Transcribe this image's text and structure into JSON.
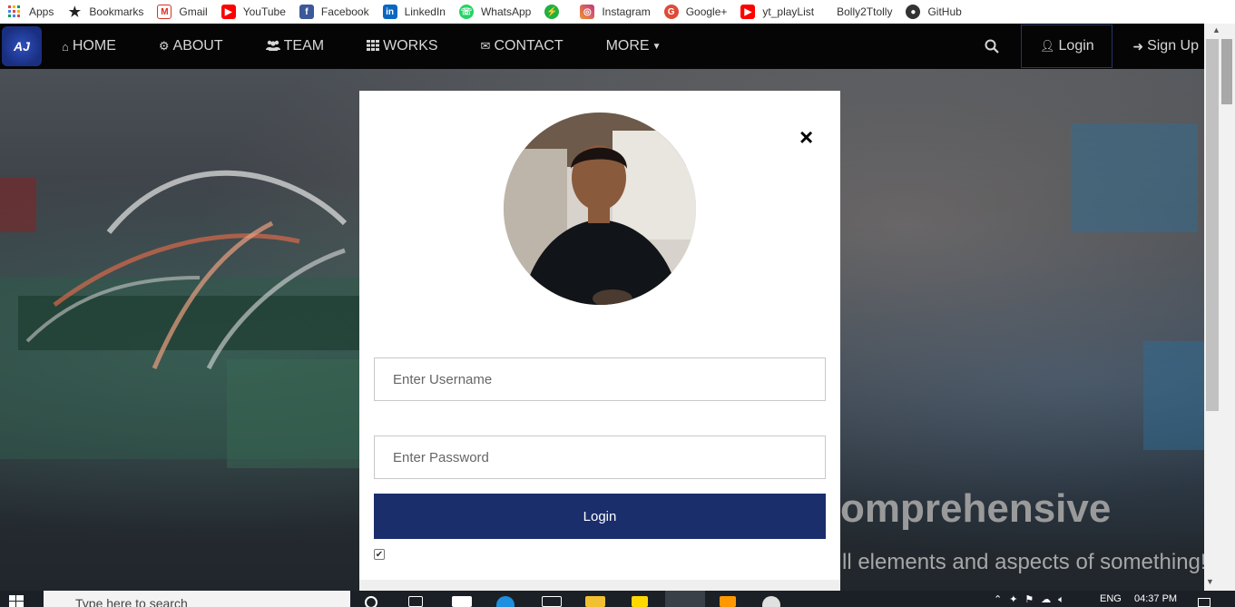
{
  "bookmarks": [
    {
      "label": "Apps",
      "icon": "apps-grid-icon",
      "color": "#e04a3f"
    },
    {
      "label": "Bookmarks",
      "icon": "star-icon",
      "color": "#222222"
    },
    {
      "label": "Gmail",
      "icon": "gmail-icon",
      "color": "#d93025"
    },
    {
      "label": "YouTube",
      "icon": "youtube-icon",
      "color": "#ff0000"
    },
    {
      "label": "Facebook",
      "icon": "facebook-icon",
      "color": "#3b5998"
    },
    {
      "label": "LinkedIn",
      "icon": "linkedin-icon",
      "color": "#0a66c2"
    },
    {
      "label": "WhatsApp",
      "icon": "whatsapp-icon",
      "color": "#25d366"
    },
    {
      "label": "",
      "icon": "bolt-icon",
      "color": "#1fb141"
    },
    {
      "label": "Instagram",
      "icon": "instagram-icon",
      "color": "#c13584"
    },
    {
      "label": "Google+",
      "icon": "google-plus-icon",
      "color": "#dd4b39"
    },
    {
      "label": "yt_playList",
      "icon": "youtube-icon",
      "color": "#ff0000"
    },
    {
      "label": "Bolly2Ttolly",
      "icon": "",
      "color": "#ffffff"
    },
    {
      "label": "GitHub",
      "icon": "github-icon",
      "color": "#333333"
    }
  ],
  "nav": {
    "logo": "AJ",
    "items": [
      {
        "label": "HOME",
        "icon": "home-icon"
      },
      {
        "label": "ABOUT",
        "icon": "gear-icon"
      },
      {
        "label": "TEAM",
        "icon": "users-icon"
      },
      {
        "label": "WORKS",
        "icon": "grid-icon"
      },
      {
        "label": "CONTACT",
        "icon": "envelope-icon"
      },
      {
        "label": "MORE",
        "icon": "caret-down-icon"
      }
    ],
    "login": "Login",
    "signup": "Sign Up"
  },
  "hero": {
    "title": "omprehensive",
    "subtitle": "ll elements and aspects of something!"
  },
  "modal": {
    "close": "×",
    "username_placeholder": "Enter Username",
    "password_placeholder": "Enter Password",
    "login_button": "Login",
    "remember_checked": true
  },
  "taskbar": {
    "search_placeholder": "Type here to search",
    "language": "ENG",
    "time": "04:37 PM"
  },
  "colors": {
    "nav_bg": "#050505",
    "accent": "#1a2e6c"
  }
}
